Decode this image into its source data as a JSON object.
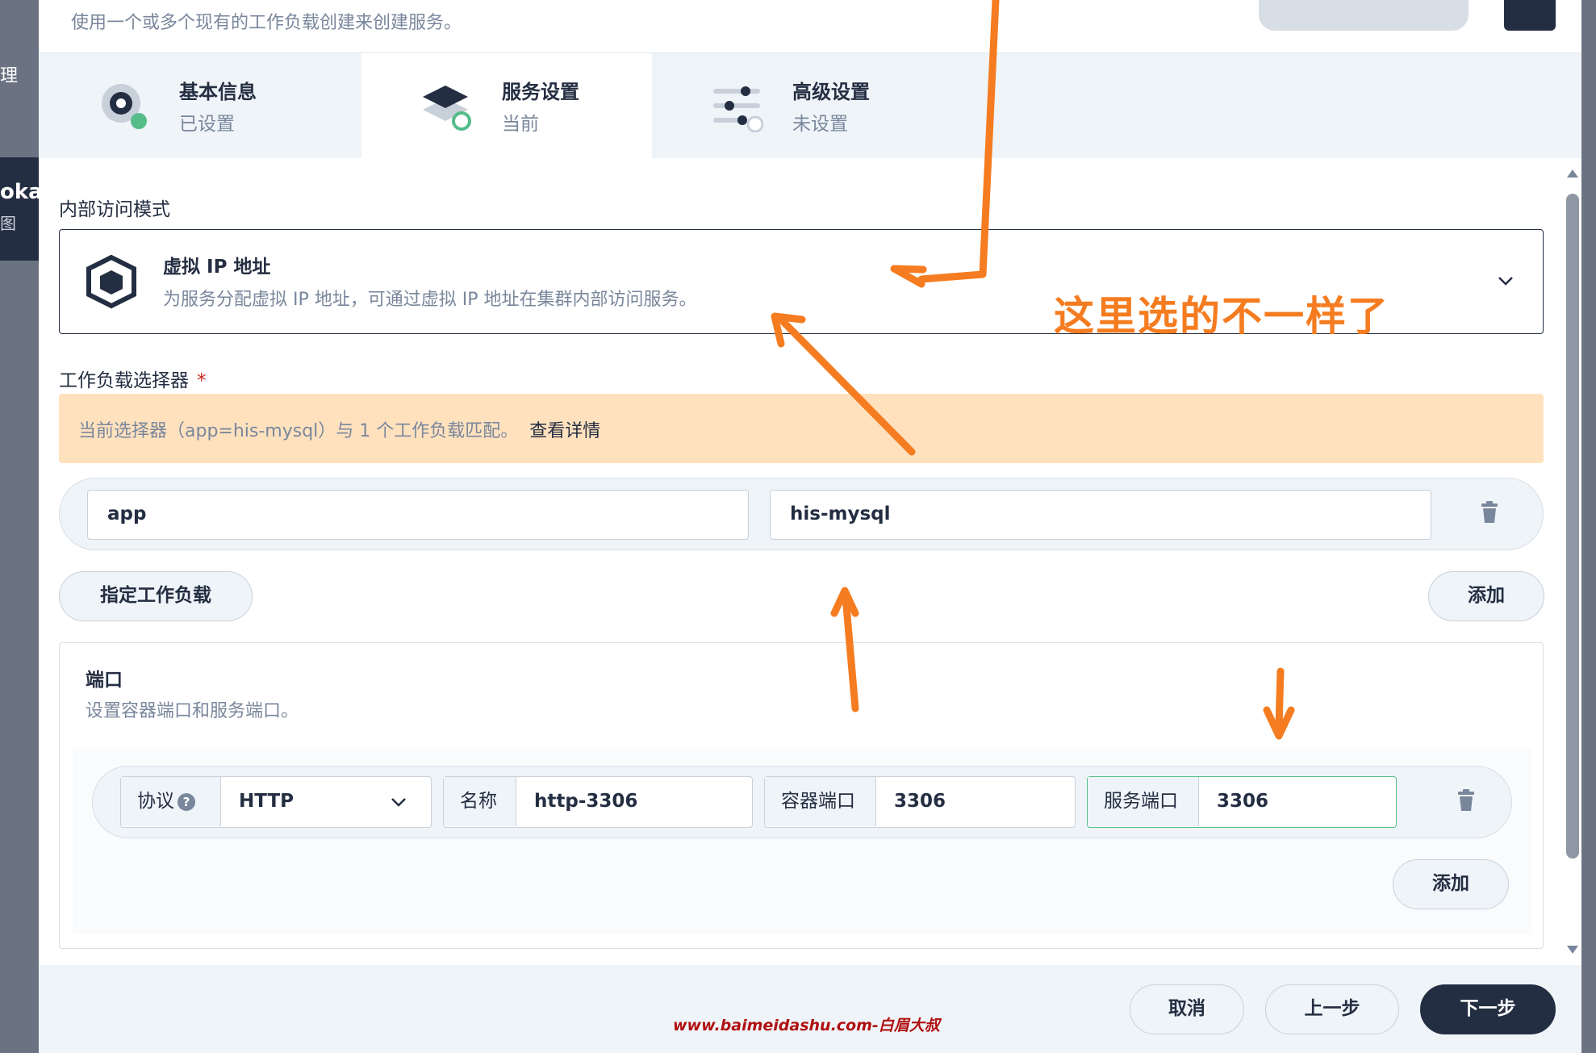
{
  "background": {
    "left_text_top": "理",
    "left_text_mid": "oka",
    "left_text_low": "图"
  },
  "modal": {
    "top_description": "使用一个或多个现有的工作负载创建来创建服务。"
  },
  "steps": [
    {
      "title": "基本信息",
      "status": "已设置"
    },
    {
      "title": "服务设置",
      "status": "当前"
    },
    {
      "title": "高级设置",
      "status": "未设置"
    }
  ],
  "access_mode": {
    "label": "内部访问模式",
    "selected_title": "虚拟 IP 地址",
    "selected_desc": "为服务分配虚拟 IP 地址，可通过虚拟 IP 地址在集群内部访问服务。"
  },
  "selector": {
    "label": "工作负载选择器",
    "required_mark": "*",
    "notice": "当前选择器（app=his-mysql）与 1 个工作负载匹配。",
    "notice_link": "查看详情",
    "key": "app",
    "value": "his-mysql",
    "specify_button": "指定工作负载",
    "add_button": "添加"
  },
  "ports": {
    "title": "端口",
    "description": "设置容器端口和服务端口。",
    "protocol_label": "协议",
    "protocol_help": "?",
    "protocol_value": "HTTP",
    "name_label": "名称",
    "name_value": "http-3306",
    "container_port_label": "容器端口",
    "container_port_value": "3306",
    "service_port_label": "服务端口",
    "service_port_value": "3306",
    "add_button": "添加"
  },
  "footer": {
    "cancel": "取消",
    "prev": "上一步",
    "next": "下一步",
    "watermark": "www.baimeidashu.com-白眉大叔"
  },
  "annotation": {
    "text": "这里选的不一样了",
    "color": "#f57c20"
  },
  "colors": {
    "primary_dark": "#242e42",
    "success_green": "#55bc8a",
    "warning_bg": "#ffe1be",
    "required_red": "#ca2621"
  }
}
